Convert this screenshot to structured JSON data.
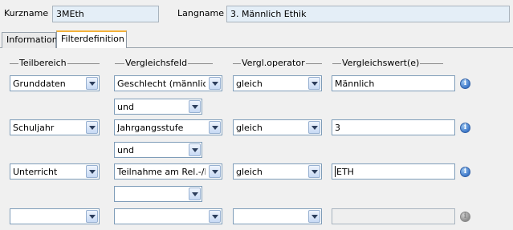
{
  "header": {
    "kurzname_label": "Kurzname",
    "kurzname_value": "3MEth",
    "langname_label": "Langname",
    "langname_value": "3. Männlich Ethik"
  },
  "tabs": [
    {
      "label": "Information",
      "active": false
    },
    {
      "label": "Filterdefinition",
      "active": true
    }
  ],
  "columns": {
    "teilbereich": "Teilbereich",
    "vergleichsfeld": "Vergleichsfeld",
    "operator": "Vergl.operator",
    "vergleichswert": "Vergleichswert(e)"
  },
  "rows": [
    {
      "teilbereich": "Grunddaten",
      "feld": "Geschlecht (männlich/weiblich)",
      "operator": "gleich",
      "wert": "Männlich",
      "connector": "und"
    },
    {
      "teilbereich": "Schuljahr",
      "feld": "Jahrgangsstufe",
      "operator": "gleich",
      "wert": "3",
      "connector": "und"
    },
    {
      "teilbereich": "Unterricht",
      "feld": "Teilnahme am Rel.-/Ethikunterricht",
      "operator": "gleich",
      "wert": "ETH",
      "connector": ""
    },
    {
      "teilbereich": "",
      "feld": "",
      "operator": "",
      "wert": "",
      "connector": null
    }
  ],
  "icons": {
    "info": "info-icon",
    "dropdown": "chevron-down-icon"
  },
  "colors": {
    "active_tab_accent": "#f4b23a",
    "info_icon": "#3f79c9",
    "field_bg": "#e4eef7"
  }
}
